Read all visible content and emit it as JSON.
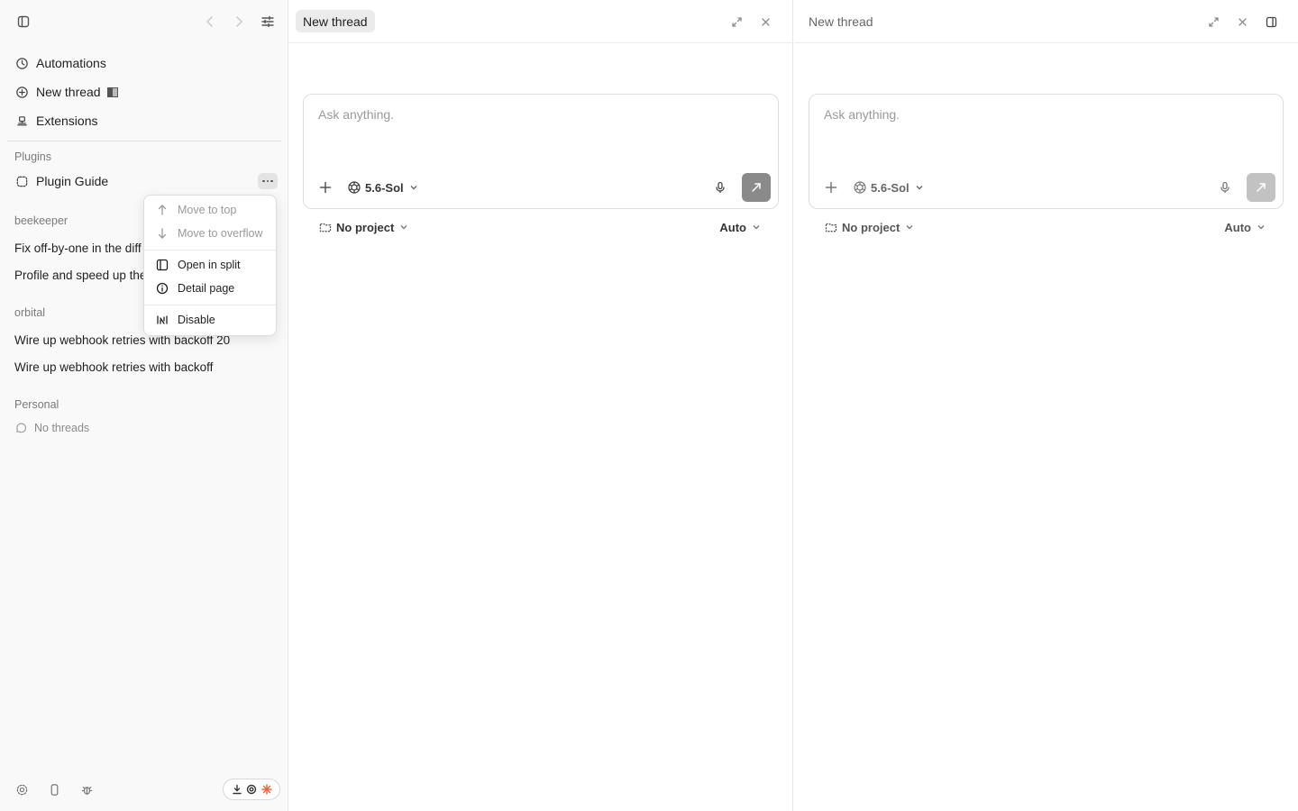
{
  "sidebar": {
    "nav": [
      {
        "label": "Automations",
        "icon": "clock-icon"
      },
      {
        "label": "New thread",
        "icon": "plus-circle-icon"
      },
      {
        "label": "Extensions",
        "icon": "extensions-icon"
      }
    ],
    "plugins_label": "Plugins",
    "plugin_item": "Plugin Guide",
    "groups": [
      {
        "label": "beekeeper",
        "threads": [
          "Fix off-by-one in the diff",
          "Profile and speed up the"
        ]
      },
      {
        "label": "orbital",
        "threads": [
          "Wire up webhook retries with backoff 20",
          "Wire up webhook retries with backoff"
        ]
      },
      {
        "label": "Personal",
        "empty": "No threads"
      }
    ]
  },
  "context_menu": {
    "items": [
      "Move to top",
      "Move to overflow",
      "Open in split",
      "Detail page",
      "Disable"
    ],
    "disabled": [
      true,
      true,
      false,
      false,
      false
    ]
  },
  "panes": [
    {
      "tab": "New thread",
      "active": true,
      "placeholder": "Ask anything.",
      "model": "5.6-Sol",
      "project": "No project",
      "mode": "Auto",
      "send_color": "#8a8a8a"
    },
    {
      "tab": "New thread",
      "active": false,
      "placeholder": "Ask anything.",
      "model": "5.6-Sol",
      "project": "No project",
      "mode": "Auto",
      "send_color": "#c2c2c2"
    }
  ],
  "colors": {
    "accent_star": "#e8623d"
  }
}
